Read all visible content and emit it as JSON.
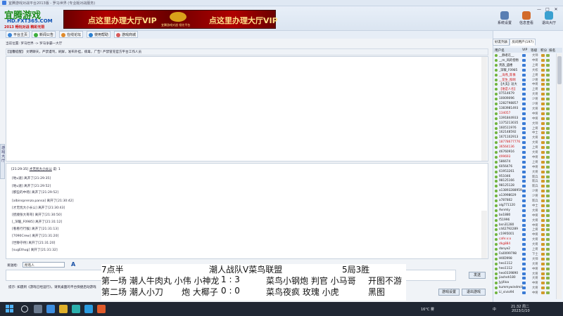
{
  "window": {
    "title": "宜腾游戏对战平台2013版 - 罗马世界 (专业版对战服务)"
  },
  "banner": {
    "logo_line1": "宜腾游戏",
    "logo_line2": "HD.FXT365.COM",
    "logo_line3": "2013 畅玩对战 精彩无限",
    "vip_text_left": "点这里办理大厅VIP",
    "vip_text_right": "点这里办理大厅VIP",
    "vip_emblem_caption": "宜腾游戏对战 领先平台",
    "buttons": [
      {
        "label": "系统设置",
        "color": "#5a7fb3"
      },
      {
        "label": "信息查看",
        "color": "#d26a2a"
      },
      {
        "label": "退出大厅",
        "color": "#3aa0d0"
      }
    ],
    "window_controls": [
      "—",
      "□",
      "✕"
    ]
  },
  "toolbar": {
    "items": [
      {
        "label": "平台主页",
        "color": "#3b86d9"
      },
      {
        "label": "新闻公告",
        "color": "#3cae3c"
      },
      {
        "label": "在线论坛",
        "color": "#e08a2a"
      },
      {
        "label": "使用帮助",
        "color": "#2a7fd0"
      },
      {
        "label": "游戏商城",
        "color": "#d85a5a"
      }
    ]
  },
  "location": {
    "text": "当前位置: 罗马世界 -> 罗马争霸一大厅"
  },
  "notice": {
    "text": "【温馨提醒】 文明聊天，严禁谩骂，刷屏，发布外挂，病毒，广告! 严禁冒充官方平台工作人员"
  },
  "side_tab": {
    "label": "游戏大厅"
  },
  "messages": {
    "header_time": "[21:29:35]",
    "header_user": "才无忧大小长公",
    "header_suffix": "说: 1",
    "lines": [
      "[地u速] 离开了[21:29:35]",
      "[地u速] 离开了[21:29:52]",
      "[那些的中场] 离开了[21:29:52]",
      "[albinsprenzo.pansa] 离开了[21:30:42]",
      "[才无忧大小长公] 离开了[21:30:43]",
      "[抚顺张大哥哥] 离开了[21:30:50]",
      "[_深暖_F0985] 离开了[21:31:12]",
      "[看看行行猴] 离开了[21:31:13]",
      "[7090Crew] 离开了[21:31:20]",
      "[世静守待] 离开了[21:31:20]",
      "[sugEthug] 离开了[21:31:32]"
    ]
  },
  "send": {
    "label": "发送给:",
    "target": "所有人",
    "font_button": "A",
    "send_button": "发送",
    "tip": "提示: 如遇到《游戏已经运行》，请到桌面的平台快捷启动游戏",
    "bottom_buttons": [
      "游戏设置",
      "退出游戏"
    ]
  },
  "overlay": {
    "row0_left": "7点半",
    "row0_mid": "潮人战队V菜鸟联盟",
    "row0_right": "5局3胜",
    "row1": "第一场 潮人牛肉丸 小伟 小神龙",
    "row1_score": "1  :  3",
    "row1_right": "菜鸟小钢炮 判官 小马哥",
    "row1_note": "开图不游",
    "row2": "第二场 潮人小刀",
    "row2_mid": "炮  大椰子",
    "row2_score": "0  :  0",
    "row2_right": "菜鸟夜疯 玫瑰 小虎",
    "row2_note": "黑图"
  },
  "right_panel": {
    "tabs": [
      "好友列表",
      "房间用户(197)"
    ],
    "columns": [
      "用户名",
      "VIP",
      "等级",
      "积分",
      "排名"
    ],
    "users": [
      {
        "name": "__静者在__",
        "rank": "大师",
        "red": false
      },
      {
        "name": "__m_风的怪物",
        "rank": "中将",
        "red": false
      },
      {
        "name": "贵族_盛楼",
        "rank": "上将",
        "red": false
      },
      {
        "name": "_深暖_F0985",
        "rank": "大校",
        "red": false
      },
      {
        "name": "__海燕_陈像",
        "rank": "上将",
        "red": true
      },
      {
        "name": "__花生_照啊",
        "rank": "少将",
        "red": true
      },
      {
        "name": "【大夫】逗大",
        "rank": "中将",
        "red": false
      },
      {
        "name": "【谁是人名】",
        "rank": "上将",
        "red": true
      },
      {
        "name": "07514679",
        "rank": "大将",
        "red": false
      },
      {
        "name": "10009096",
        "rank": "少将",
        "red": false
      },
      {
        "name": "1282798857",
        "rank": "少将",
        "red": false
      },
      {
        "name": "1383981493",
        "rank": "大将",
        "red": false
      },
      {
        "name": "134057",
        "rank": "中将",
        "red": true
      },
      {
        "name": "1391844933",
        "rank": "中将",
        "red": false
      },
      {
        "name": "1375213035",
        "rank": "大师",
        "red": false
      },
      {
        "name": "160511976",
        "rank": "上将",
        "red": false
      },
      {
        "name": "162148592",
        "rank": "中士",
        "red": false
      },
      {
        "name": "1671102913",
        "rank": "大将",
        "red": false
      },
      {
        "name": "18778677776",
        "rank": "大将",
        "red": true
      },
      {
        "name": "36564136",
        "rank": "上将",
        "red": true
      },
      {
        "name": "46760916",
        "rank": "大将",
        "red": false
      },
      {
        "name": "499693",
        "rank": "中将",
        "red": true
      },
      {
        "name": "586674",
        "rank": "上将",
        "red": false
      },
      {
        "name": "6056476",
        "rank": "中将",
        "red": false
      },
      {
        "name": "61953261",
        "rank": "大将",
        "red": false
      },
      {
        "name": "951046",
        "rank": "新兵",
        "red": false
      },
      {
        "name": "98125166",
        "rank": "新兵",
        "red": false
      },
      {
        "name": "98125128",
        "rank": "新兵",
        "red": false
      },
      {
        "name": "a13893288959",
        "rank": "少将",
        "red": false
      },
      {
        "name": "a13998029",
        "rank": "少将",
        "red": false
      },
      {
        "name": "a787802",
        "rank": "新兵",
        "red": false
      },
      {
        "name": "alg771120",
        "rank": "中士",
        "red": false
      },
      {
        "name": "Avnmly",
        "rank": "大将",
        "red": false
      },
      {
        "name": "bo1880",
        "rank": "中将",
        "red": false
      },
      {
        "name": "f51996",
        "rank": "大将",
        "red": false
      },
      {
        "name": "bsn31280",
        "rank": "中将",
        "red": false
      },
      {
        "name": "c442792289",
        "rank": "上将",
        "red": false
      },
      {
        "name": "c1995001",
        "rank": "中将",
        "red": false
      },
      {
        "name": "cafe:x:o",
        "rank": "大将",
        "red": true
      },
      {
        "name": "dkg884",
        "rank": "大将",
        "red": true
      },
      {
        "name": "danye2",
        "rank": "上将",
        "red": false
      },
      {
        "name": "Fai0099798",
        "rank": "下士",
        "red": false
      },
      {
        "name": "HI0D998",
        "rank": "大师",
        "red": false
      },
      {
        "name": "heo1112",
        "rank": "大将",
        "red": false
      },
      {
        "name": "heo1112",
        "rank": "中将",
        "red": false
      },
      {
        "name": "heo0339890",
        "rank": "大将",
        "red": false
      },
      {
        "name": "jiasheh180",
        "rank": "大将",
        "red": false
      },
      {
        "name": "Jyj4loa",
        "rank": "中将",
        "red": false
      },
      {
        "name": "kummywindmill",
        "rank": "大将",
        "red": false
      },
      {
        "name": "Ll_vivio94",
        "rank": "中将",
        "red": false
      }
    ]
  },
  "taskbar": {
    "temp": "16°C 雾",
    "ime": "中",
    "time": "21:32 周二",
    "date": "2023/1/10"
  }
}
